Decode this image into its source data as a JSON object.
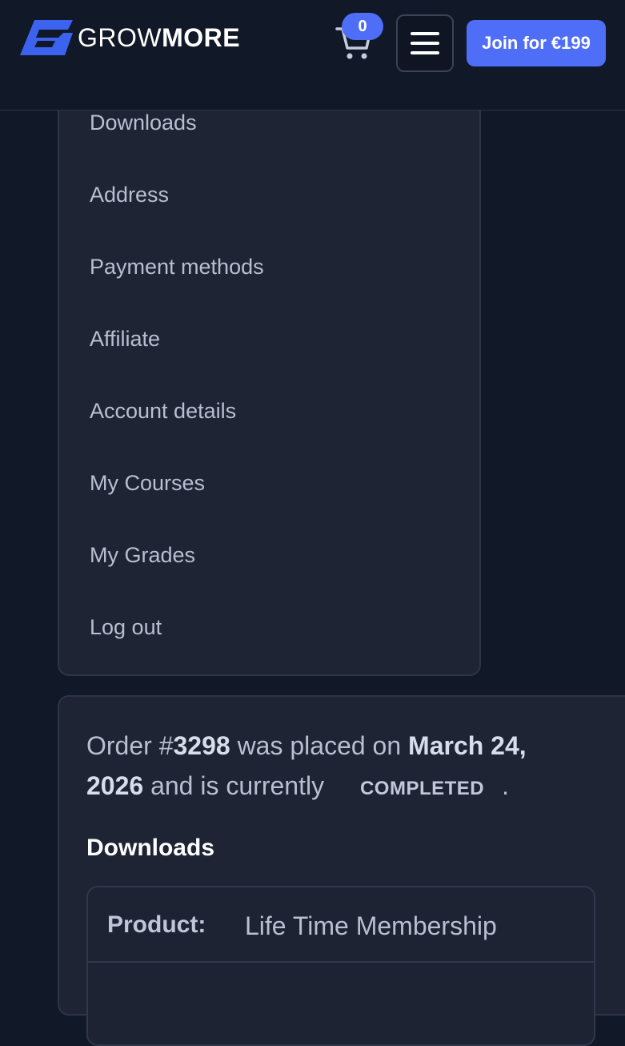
{
  "header": {
    "logo_part1": "GROW",
    "logo_part2": "MORE",
    "cart_count": "0",
    "join_label": "Join for €199"
  },
  "account_nav": {
    "items": [
      {
        "label": "Downloads"
      },
      {
        "label": "Address"
      },
      {
        "label": "Payment methods"
      },
      {
        "label": "Affiliate"
      },
      {
        "label": "Account details"
      },
      {
        "label": "My Courses"
      },
      {
        "label": "My Grades"
      },
      {
        "label": "Log out"
      }
    ]
  },
  "order": {
    "prefix": "Order #",
    "number": "3298",
    "placed_text": " was placed on ",
    "date_part1": "March 24,",
    "date_part2": "2026",
    "current_text": " and is currently ",
    "status": "COMPLETED",
    "suffix": ".",
    "downloads_title": "Downloads",
    "product_label": "Product:",
    "product_value": "Life Time Membership"
  },
  "colors": {
    "accent": "#4f6ef7",
    "background": "#111827",
    "card": "#1e2433"
  },
  "icons": [
    "logo-g-icon",
    "cart-icon",
    "menu-icon"
  ]
}
